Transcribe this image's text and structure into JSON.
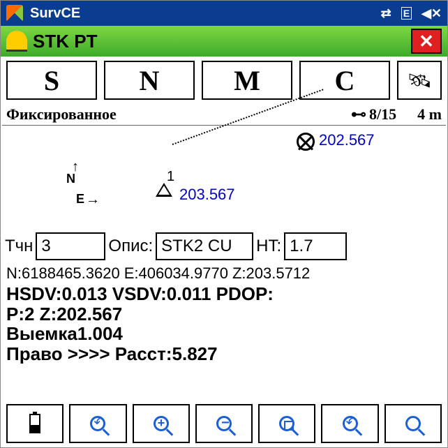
{
  "taskbar": {
    "title": "SurvCE"
  },
  "titlebar": {
    "title": "STK PT"
  },
  "letter_buttons": [
    "S",
    "N",
    "M",
    "C"
  ],
  "status": {
    "fix": "Фиксированное",
    "sats": "8/15",
    "dist": "4 m"
  },
  "map": {
    "north": "N",
    "east": "E",
    "pt1_num": "1",
    "pt1_label": "203.567",
    "pt2_label": "202.567"
  },
  "inputs": {
    "pt_label": "Тчн",
    "pt_value": "3",
    "desc_label": "Опис:",
    "desc_value": "STK2 CU",
    "ht_label": "HT:",
    "ht_value": "1.7"
  },
  "coords": {
    "n": "N:6188465.3620",
    "e": "E:406034.9770",
    "z": "Z:203.5712"
  },
  "lines": {
    "l1": "HSDV:0.013 VSDV:0.011 PDOP:",
    "l2": "P:2 Z:202.567",
    "l3": "Выемка1.004",
    "l4": "Право >>>> Расст:5.827"
  }
}
